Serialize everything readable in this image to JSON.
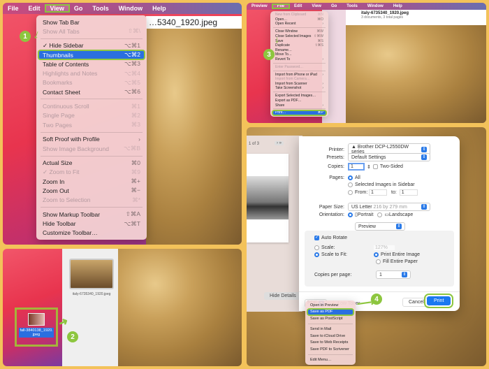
{
  "step1": {
    "menubar": [
      "File",
      "Edit",
      "View",
      "Go",
      "Tools",
      "Window",
      "Help"
    ],
    "active_menu": "View",
    "window_title": "…5340_1920.jpeg",
    "badge": "1",
    "menu_items": [
      {
        "label": "Show Tab Bar",
        "shortcut": "",
        "state": "normal"
      },
      {
        "label": "Show All Tabs",
        "shortcut": "⇧⌘\\",
        "state": "disabled"
      },
      {
        "sep": true
      },
      {
        "label": "Hide Sidebar",
        "shortcut": "⌥⌘1",
        "state": "checked"
      },
      {
        "label": "Thumbnails",
        "shortcut": "⌥⌘2",
        "state": "selected"
      },
      {
        "label": "Table of Contents",
        "shortcut": "⌥⌘3",
        "state": "normal"
      },
      {
        "label": "Highlights and Notes",
        "shortcut": "⌥⌘4",
        "state": "disabled"
      },
      {
        "label": "Bookmarks",
        "shortcut": "⌥⌘5",
        "state": "disabled"
      },
      {
        "label": "Contact Sheet",
        "shortcut": "⌥⌘6",
        "state": "normal"
      },
      {
        "sep": true
      },
      {
        "label": "Continuous Scroll",
        "shortcut": "⌘1",
        "state": "disabled"
      },
      {
        "label": "Single Page",
        "shortcut": "⌘2",
        "state": "disabled"
      },
      {
        "label": "Two Pages",
        "shortcut": "⌘3",
        "state": "disabled"
      },
      {
        "sep": true
      },
      {
        "label": "Soft Proof with Profile",
        "shortcut": "›",
        "state": "normal"
      },
      {
        "label": "Show Image Background",
        "shortcut": "⌥⌘B",
        "state": "disabled"
      },
      {
        "sep": true
      },
      {
        "label": "Actual Size",
        "shortcut": "⌘0",
        "state": "normal"
      },
      {
        "label": "Zoom to Fit",
        "shortcut": "⌘9",
        "state": "checked-disabled"
      },
      {
        "label": "Zoom In",
        "shortcut": "⌘+",
        "state": "normal"
      },
      {
        "label": "Zoom Out",
        "shortcut": "⌘−",
        "state": "normal"
      },
      {
        "label": "Zoom to Selection",
        "shortcut": "⌘*",
        "state": "disabled"
      },
      {
        "sep": true
      },
      {
        "label": "Show Markup Toolbar",
        "shortcut": "⇧⌘A",
        "state": "normal"
      },
      {
        "label": "Hide Toolbar",
        "shortcut": "⌥⌘T",
        "state": "normal"
      },
      {
        "label": "Customize Toolbar…",
        "shortcut": "",
        "state": "normal"
      }
    ]
  },
  "step2": {
    "badge": "2",
    "desktop_file": "fall-3840138_1920.jpeg",
    "thumbnail_caption": "italy-6735340_1920.jpeg"
  },
  "step3": {
    "badge": "3",
    "menubar": [
      "Preview",
      "File",
      "Edit",
      "View",
      "Go",
      "Tools",
      "Window",
      "Help"
    ],
    "active_menu": "File",
    "window_title": "italy-6735340_1920.jpeg",
    "window_subtitle": "3 documents, 3 total pages",
    "menu_items": [
      {
        "label": "New from Clipboard",
        "shortcut": "⌘N",
        "state": "disabled"
      },
      {
        "label": "Open…",
        "shortcut": "⌘O",
        "state": "normal"
      },
      {
        "label": "Open Recent",
        "shortcut": "›",
        "state": "normal"
      },
      {
        "sep": true
      },
      {
        "label": "Close Window",
        "shortcut": "⌘W",
        "state": "normal"
      },
      {
        "label": "Close Selected Images",
        "shortcut": "⇧⌘W",
        "state": "normal"
      },
      {
        "label": "Save",
        "shortcut": "⌘S",
        "state": "normal"
      },
      {
        "label": "Duplicate",
        "shortcut": "⇧⌘S",
        "state": "normal"
      },
      {
        "label": "Rename…",
        "shortcut": "",
        "state": "normal"
      },
      {
        "label": "Move To…",
        "shortcut": "",
        "state": "normal"
      },
      {
        "label": "Revert To",
        "shortcut": "›",
        "state": "normal"
      },
      {
        "sep": true
      },
      {
        "label": "Enter Password…",
        "shortcut": "",
        "state": "disabled"
      },
      {
        "sep": true
      },
      {
        "label": "Import from iPhone or iPad",
        "shortcut": "›",
        "state": "normal"
      },
      {
        "label": "Import from Camera…",
        "shortcut": "",
        "state": "disabled"
      },
      {
        "label": "Import from Scanner",
        "shortcut": "›",
        "state": "normal"
      },
      {
        "label": "Take Screenshot",
        "shortcut": "›",
        "state": "normal"
      },
      {
        "sep": true
      },
      {
        "label": "Export Selected Images…",
        "shortcut": "",
        "state": "normal"
      },
      {
        "label": "Export as PDF…",
        "shortcut": "",
        "state": "normal"
      },
      {
        "label": "Share",
        "shortcut": "›",
        "state": "normal"
      },
      {
        "sep": true
      },
      {
        "label": "Print…",
        "shortcut": "⌘P",
        "state": "selected"
      }
    ]
  },
  "step4": {
    "badge": "4",
    "page_indicator": "1 of 3",
    "nav_next": "›",
    "nav_last": "»",
    "printer_label": "Printer:",
    "printer_value": "Brother DCP-L2550DW series",
    "presets_label": "Presets:",
    "presets_value": "Default Settings",
    "copies_label": "Copies:",
    "copies_value": "1",
    "two_sided": "Two-Sided",
    "pages_label": "Pages:",
    "pages_all": "All",
    "pages_selected": "Selected Images in Sidebar",
    "pages_from": "From:",
    "from_value": "1",
    "pages_to": "to:",
    "to_value": "1",
    "paper_label": "Paper Size:",
    "paper_value": "US Letter",
    "paper_dims": "216 by 279 mm",
    "orientation_label": "Orientation:",
    "portrait": "Portrait",
    "landscape": "Landscape",
    "section_value": "Preview",
    "auto_rotate": "Auto Rotate",
    "scale": "Scale:",
    "scale_value": "127%",
    "scale_to_fit": "Scale to Fit:",
    "print_entire": "Print Entire Image",
    "fill_paper": "Fill Entire Paper",
    "copies_per_page": "Copies per page:",
    "copies_per_page_value": "1",
    "hide_details": "Hide Details",
    "pdf": "PDF",
    "low_toner": "Low Toner",
    "cancel": "Cancel",
    "print": "Print",
    "pdf_menu": [
      {
        "label": "Open in Preview",
        "state": "normal"
      },
      {
        "label": "Save as PDF",
        "state": "selected"
      },
      {
        "label": "Save as PostScript",
        "state": "normal"
      },
      {
        "sep": true
      },
      {
        "label": "Send in Mail",
        "state": "normal"
      },
      {
        "label": "Save to iCloud Drive",
        "state": "normal"
      },
      {
        "label": "Save to Web Receipts",
        "state": "normal"
      },
      {
        "label": "Save PDF to Scrivener",
        "state": "normal"
      },
      {
        "sep": true
      },
      {
        "label": "Edit Menu…",
        "state": "normal"
      }
    ]
  },
  "colors": {
    "highlight": "#8dc63f",
    "frame": "#f3c25a",
    "selection": "#2a6fe0"
  }
}
